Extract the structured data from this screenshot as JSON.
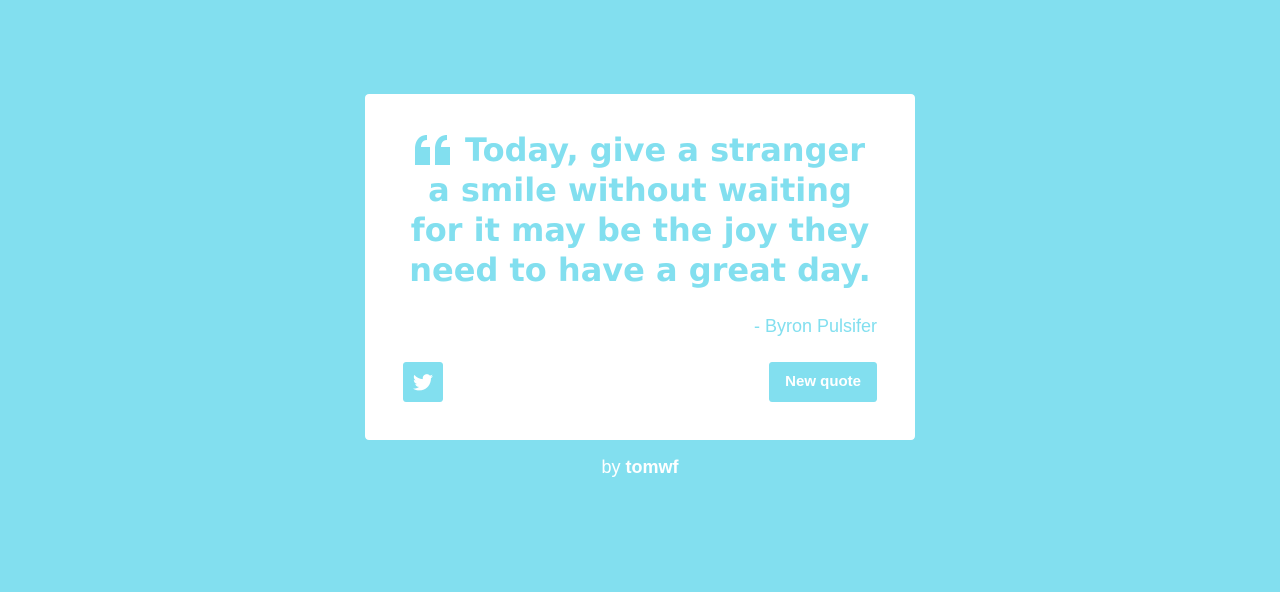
{
  "colors": {
    "background": "#82dfef",
    "card": "#ffffff",
    "accent": "#82dfef",
    "button_text": "#ffffff"
  },
  "quote": {
    "text": "Today, give a stranger a smile without waiting for it may be the joy they need to have a great day.",
    "author": "- Byron Pulsifer",
    "icon": "quote-left-icon"
  },
  "actions": {
    "tweet_icon": "twitter-icon",
    "new_quote_label": "New quote"
  },
  "footer": {
    "prefix": "by",
    "author": "tomwf"
  }
}
